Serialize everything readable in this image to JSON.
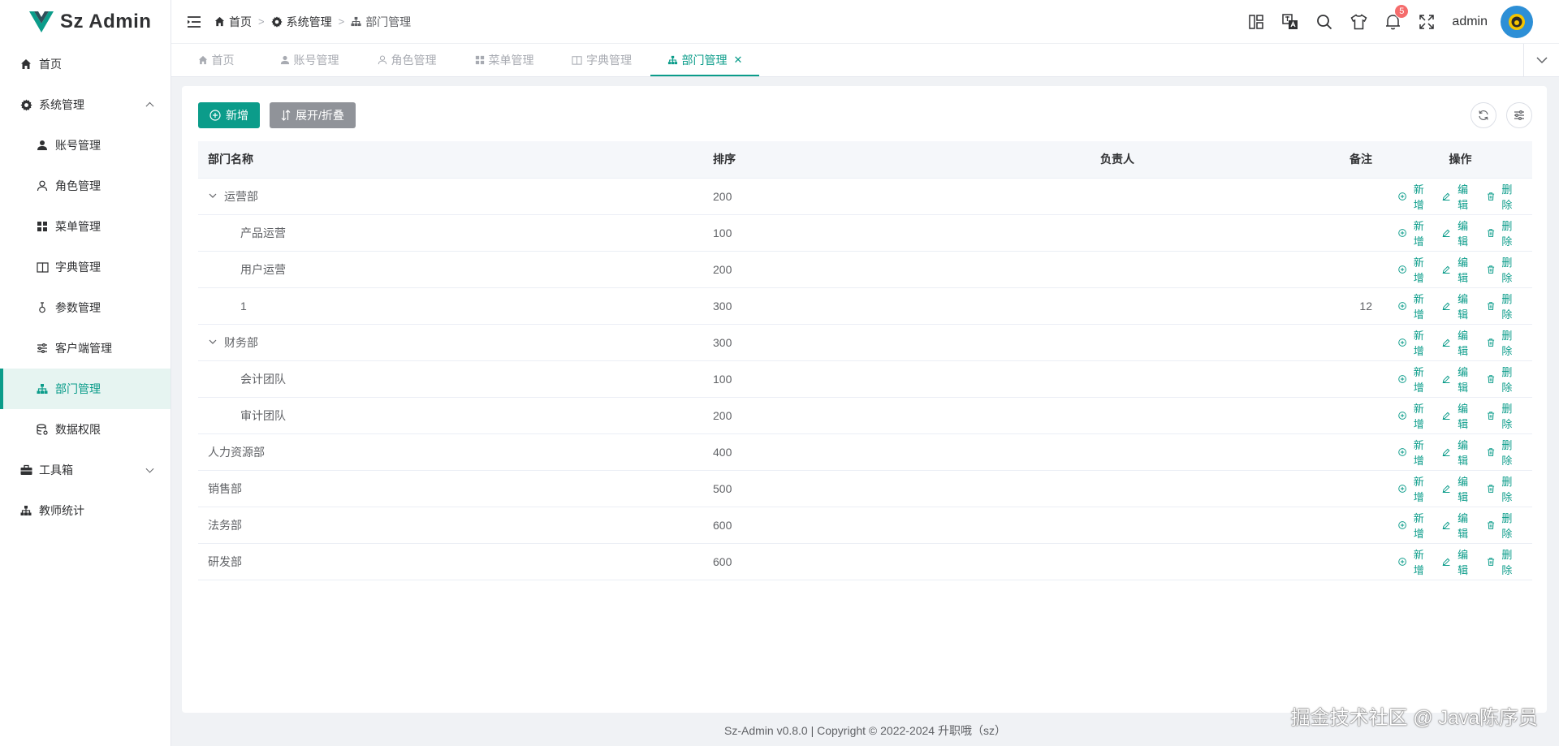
{
  "app": {
    "name": "Sz Admin"
  },
  "sidebar": {
    "items": [
      {
        "label": "首页",
        "icon": "home-icon"
      },
      {
        "label": "系统管理",
        "icon": "gear-icon",
        "expanded": true
      },
      {
        "label": "账号管理",
        "icon": "user-icon"
      },
      {
        "label": "角色管理",
        "icon": "user-outline-icon"
      },
      {
        "label": "菜单管理",
        "icon": "grid-icon"
      },
      {
        "label": "字典管理",
        "icon": "book-icon"
      },
      {
        "label": "参数管理",
        "icon": "parameter-icon"
      },
      {
        "label": "客户端管理",
        "icon": "sliders-icon"
      },
      {
        "label": "部门管理",
        "icon": "org-tree-icon",
        "active": true
      },
      {
        "label": "数据权限",
        "icon": "database-icon"
      },
      {
        "label": "工具箱",
        "icon": "toolbox-icon",
        "expanded": false
      },
      {
        "label": "教师统计",
        "icon": "org-tree-icon"
      }
    ]
  },
  "header": {
    "breadcrumb": [
      "首页",
      "系统管理",
      "部门管理"
    ],
    "notification_count": "5",
    "username": "admin"
  },
  "tabs": [
    {
      "label": "首页"
    },
    {
      "label": "账号管理"
    },
    {
      "label": "角色管理"
    },
    {
      "label": "菜单管理"
    },
    {
      "label": "字典管理"
    },
    {
      "label": "部门管理",
      "active": true
    }
  ],
  "toolbar": {
    "add_label": "新增",
    "toggle_label": "展开/折叠"
  },
  "table": {
    "columns": {
      "name": "部门名称",
      "sort": "排序",
      "leader": "负责人",
      "note": "备注",
      "ops": "操作"
    },
    "rows": [
      {
        "name": "运营部",
        "sort": "200",
        "leader": "",
        "note": "",
        "level": 0,
        "expandable": true
      },
      {
        "name": "产品运营",
        "sort": "100",
        "leader": "",
        "note": "",
        "level": 1,
        "expandable": false
      },
      {
        "name": "用户运营",
        "sort": "200",
        "leader": "",
        "note": "",
        "level": 1,
        "expandable": false
      },
      {
        "name": "1",
        "sort": "300",
        "leader": "",
        "note": "12",
        "level": 1,
        "expandable": false
      },
      {
        "name": "财务部",
        "sort": "300",
        "leader": "",
        "note": "",
        "level": 0,
        "expandable": true
      },
      {
        "name": "会计团队",
        "sort": "100",
        "leader": "",
        "note": "",
        "level": 1,
        "expandable": false
      },
      {
        "name": "审计团队",
        "sort": "200",
        "leader": "",
        "note": "",
        "level": 1,
        "expandable": false
      },
      {
        "name": "人力资源部",
        "sort": "400",
        "leader": "",
        "note": "",
        "level": 0,
        "expandable": false,
        "flush": true
      },
      {
        "name": "销售部",
        "sort": "500",
        "leader": "",
        "note": "",
        "level": 0,
        "expandable": false,
        "flush": true
      },
      {
        "name": "法务部",
        "sort": "600",
        "leader": "",
        "note": "",
        "level": 0,
        "expandable": false,
        "flush": true
      },
      {
        "name": "研发部",
        "sort": "600",
        "leader": "",
        "note": "",
        "level": 0,
        "expandable": false,
        "flush": true
      }
    ],
    "ops": {
      "add": "新增",
      "edit": "编辑",
      "delete": "删除"
    }
  },
  "footer": {
    "text": "Sz-Admin v0.8.0 | Copyright © 2022-2024 升职哦（sz）"
  },
  "watermark": "掘金技术社区 @ Java陈序员",
  "colors": {
    "primary": "#0b9c8a",
    "danger": "#f56c6c",
    "avatar": "#2d8fd6"
  }
}
